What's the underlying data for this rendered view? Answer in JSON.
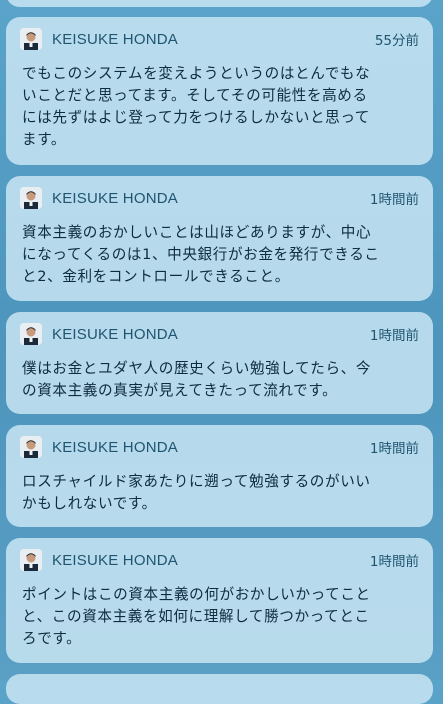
{
  "notifications": [
    {
      "sender": "KEISUKE HONDA",
      "time": "55分前",
      "message": "でもこのシステムを変えようというのはとんでもな\nいことだと思ってます。そしてその可能性を高める\nには先ずはよじ登って力をつけるしかないと思って\nます。"
    },
    {
      "sender": "KEISUKE HONDA",
      "time": "1時間前",
      "message": "資本主義のおかしいことは山ほどありますが、中心\nになってくるのは1、中央銀行がお金を発行できるこ\nと2、金利をコントロールできること。"
    },
    {
      "sender": "KEISUKE HONDA",
      "time": "1時間前",
      "message": "僕はお金とユダヤ人の歴史くらい勉強してたら、今\nの資本主義の真実が見えてきたって流れです。"
    },
    {
      "sender": "KEISUKE HONDA",
      "time": "1時間前",
      "message": "ロスチャイルド家あたりに遡って勉強するのがいい\nかもしれないです。"
    },
    {
      "sender": "KEISUKE HONDA",
      "time": "1時間前",
      "message": "ポイントはこの資本主義の何がおかしいかってこと\nと、この資本主義を如何に理解して勝つかってとこ\nろです。"
    }
  ]
}
